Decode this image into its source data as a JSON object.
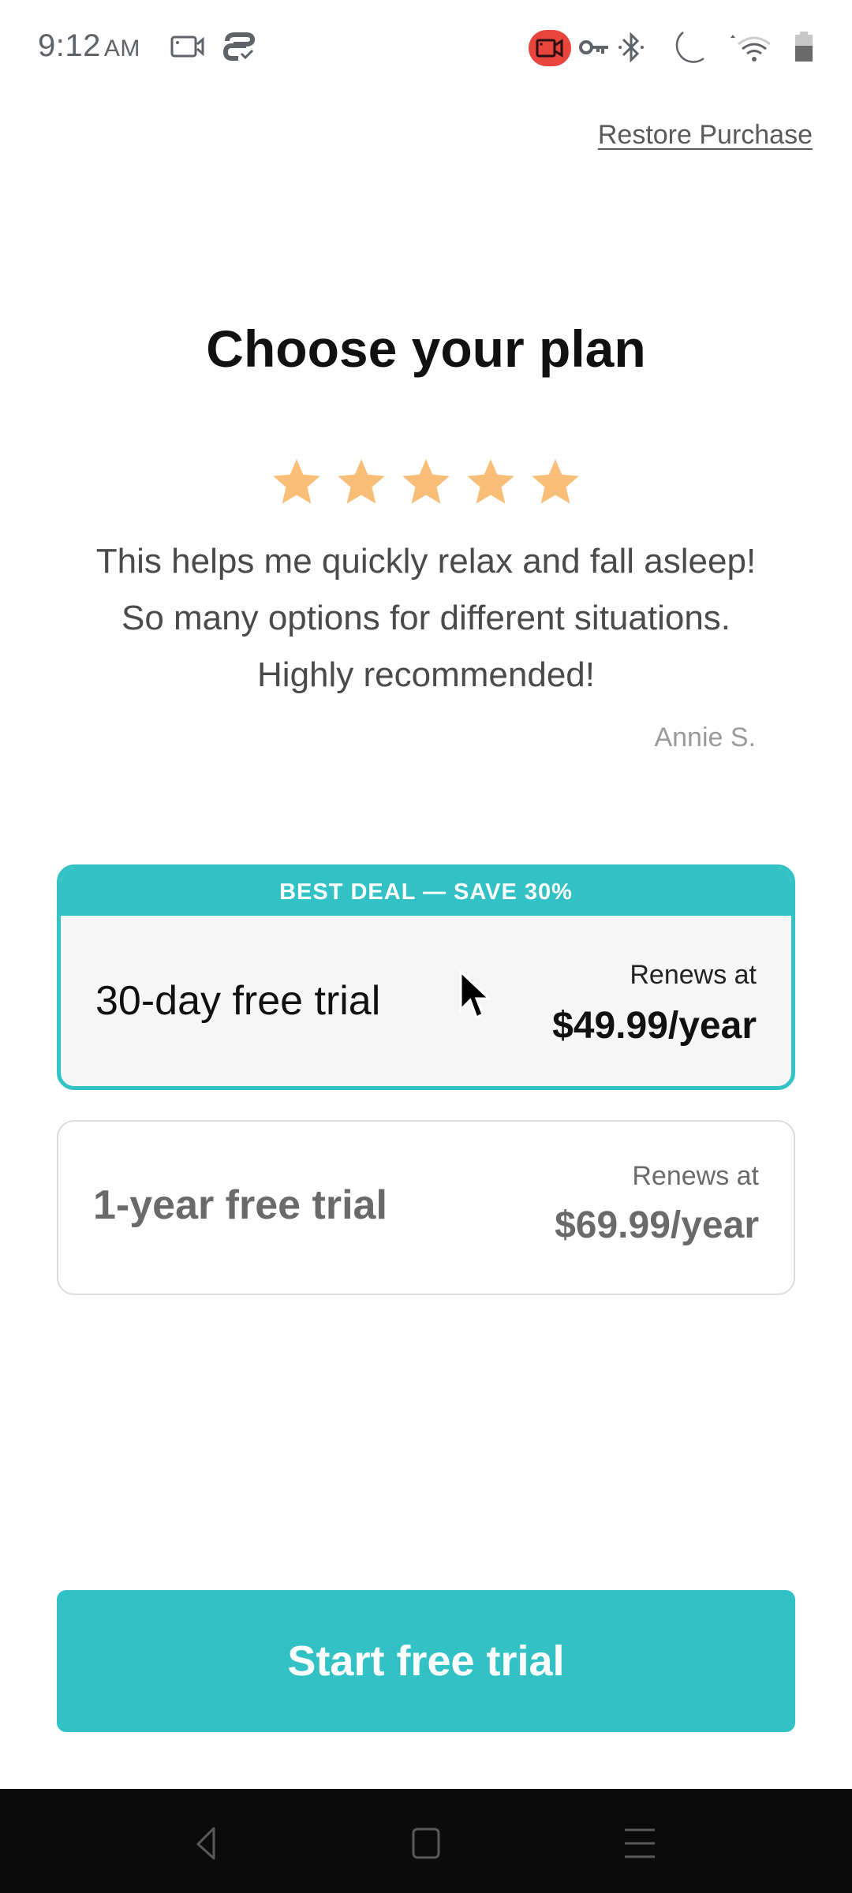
{
  "status_bar": {
    "time": "9:12",
    "ampm": "AM",
    "left_icons": [
      "screen-record-icon",
      "sync-check-icon"
    ],
    "right_icons": [
      "recording-indicator-icon",
      "vpn-key-icon",
      "bluetooth-icon",
      "do-not-disturb-icon",
      "wifi-icon",
      "battery-icon"
    ],
    "recording_color": "#e8453c"
  },
  "header": {
    "restore_label": "Restore Purchase"
  },
  "main": {
    "title": "Choose your plan",
    "rating": {
      "value": 5,
      "max": 5,
      "color": "#f8bd76"
    },
    "review": {
      "text": "This helps me quickly relax and fall asleep! So many options for different situations. Highly recommended!",
      "author": "Annie S."
    },
    "plans": [
      {
        "banner": "BEST DEAL — SAVE 30%",
        "name": "30-day free trial",
        "renews_label": "Renews at",
        "price": "$49.99/year",
        "selected": true
      },
      {
        "name": "1-year free trial",
        "renews_label": "Renews at",
        "price": "$69.99/year",
        "selected": false
      }
    ],
    "cta_label": "Start free trial"
  },
  "theme": {
    "accent": "#32c2c6"
  },
  "nav_bar": {
    "buttons": [
      "back",
      "home",
      "recents"
    ]
  }
}
